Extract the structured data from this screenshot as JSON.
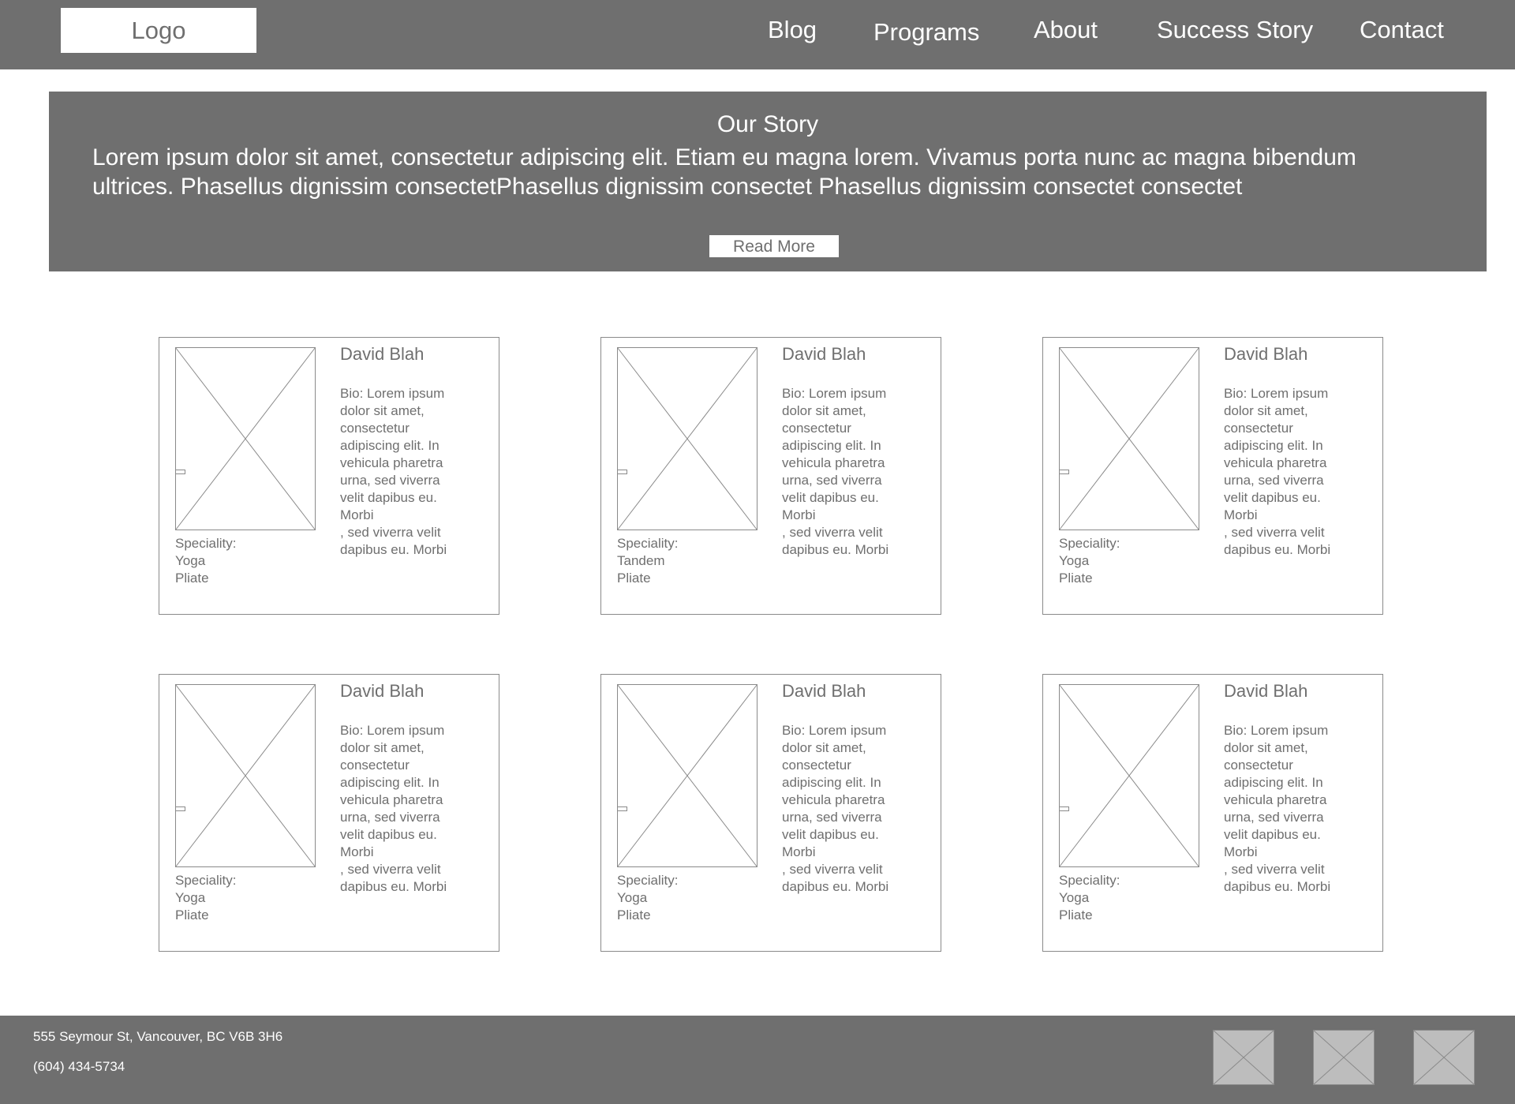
{
  "header": {
    "logo": "Logo",
    "nav": [
      {
        "label": "Blog"
      },
      {
        "label": "Programs"
      },
      {
        "label": "About"
      },
      {
        "label": "Success Story"
      },
      {
        "label": "Contact"
      }
    ]
  },
  "hero": {
    "title": "Our Story",
    "text": "Lorem ipsum dolor sit amet, consectetur adipiscing elit. Etiam eu magna lorem. Vivamus porta nunc ac magna bibendum\nultrices. Phasellus dignissim consectetPhasellus dignissim  consectet  Phasellus   dignissim   consectet  consectet",
    "read_more": "Read More"
  },
  "cards": [
    {
      "name": "David Blah",
      "bio": "Bio: Lorem ipsum\ndolor sit amet,\nconsectetur\nadipiscing elit. In\nvehicula pharetra\nurna, sed viverra\nvelit dapibus eu.\nMorbi\n, sed viverra velit\ndapibus eu. Morbi",
      "speciality_label": "Speciality:",
      "specialities": [
        "Yoga",
        "Pliate"
      ]
    },
    {
      "name": "David Blah",
      "bio": "Bio: Lorem ipsum\ndolor sit amet,\nconsectetur\nadipiscing elit. In\nvehicula pharetra\nurna, sed viverra\nvelit dapibus eu.\nMorbi\n, sed viverra velit\ndapibus eu. Morbi",
      "speciality_label": "Speciality:",
      "specialities": [
        "Tandem",
        "Pliate"
      ]
    },
    {
      "name": "David Blah",
      "bio": "Bio: Lorem ipsum\ndolor sit amet,\nconsectetur\nadipiscing elit. In\nvehicula pharetra\nurna, sed viverra\nvelit dapibus eu.\nMorbi\n, sed viverra velit\ndapibus eu. Morbi",
      "speciality_label": "Speciality:",
      "specialities": [
        "Yoga",
        "Pliate"
      ]
    },
    {
      "name": "David Blah",
      "bio": "Bio: Lorem ipsum\ndolor sit amet,\nconsectetur\nadipiscing elit. In\nvehicula pharetra\nurna, sed viverra\nvelit dapibus eu.\nMorbi\n, sed viverra velit\ndapibus eu. Morbi",
      "speciality_label": "Speciality:",
      "specialities": [
        "Yoga",
        "Pliate"
      ]
    },
    {
      "name": "David Blah",
      "bio": "Bio: Lorem ipsum\ndolor sit amet,\nconsectetur\nadipiscing elit. In\nvehicula pharetra\nurna, sed viverra\nvelit dapibus eu.\nMorbi\n, sed viverra velit\ndapibus eu. Morbi",
      "speciality_label": "Speciality:",
      "specialities": [
        "Yoga",
        "Pliate"
      ]
    },
    {
      "name": "David Blah",
      "bio": "Bio: Lorem ipsum\ndolor sit amet,\nconsectetur\nadipiscing elit. In\nvehicula pharetra\nurna, sed viverra\nvelit dapibus eu.\nMorbi\n, sed viverra velit\ndapibus eu. Morbi",
      "speciality_label": "Speciality:",
      "specialities": [
        "Yoga",
        "Pliate"
      ]
    }
  ],
  "footer": {
    "address": "555 Seymour St, Vancouver, BC V6B 3H6",
    "phone": "(604) 434-5734",
    "social_icons": [
      "image-placeholder-icon",
      "image-placeholder-icon",
      "image-placeholder-icon"
    ]
  },
  "colors": {
    "bar_gray": "#6f6f6f",
    "text_gray": "#6f6f6f",
    "white": "#ffffff"
  }
}
